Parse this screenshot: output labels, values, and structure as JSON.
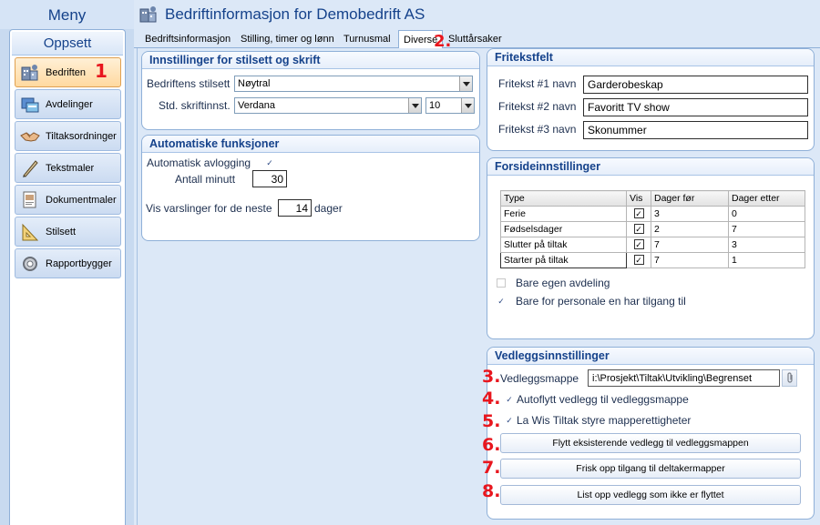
{
  "menu": {
    "title": "Meny",
    "section": "Oppsett",
    "items": [
      {
        "label": "Bedriften",
        "icon": "company-icon"
      },
      {
        "label": "Avdelinger",
        "icon": "department-icon"
      },
      {
        "label": "Tiltaksordninger",
        "icon": "handshake-icon"
      },
      {
        "label": "Tekstmaler",
        "icon": "text-template-icon"
      },
      {
        "label": "Dokumentmaler",
        "icon": "document-template-icon"
      },
      {
        "label": "Stilsett",
        "icon": "stylesheet-icon"
      },
      {
        "label": "Rapportbygger",
        "icon": "report-builder-icon"
      }
    ]
  },
  "annotations": {
    "m1": "1",
    "m2": "2.",
    "m3": "3.",
    "m4": "4.",
    "m5": "5.",
    "m6": "6.",
    "m7": "7.",
    "m8": "8."
  },
  "page": {
    "title": "Bedriftinformasjon for Demobedrift AS"
  },
  "tabs": [
    "Bedriftsinformasjon",
    "Stilling, timer og lønn",
    "Turnusmal",
    "Diverse",
    "Sluttårsaker"
  ],
  "style_settings": {
    "title": "Innstillinger for stilsett og skrift",
    "company_style_label": "Bedriftens stilsett",
    "company_style_value": "Nøytral",
    "font_label": "Std. skriftinnst.",
    "font_value": "Verdana",
    "font_size_value": "10"
  },
  "auto_functions": {
    "title": "Automatiske funksjoner",
    "auto_logout_label": "Automatisk avlogging",
    "auto_logout_checked": "✓",
    "minutes_label": "Antall minutt",
    "minutes_value": "30",
    "notify_label": "Vis varslinger for de neste",
    "notify_value": "14",
    "days_label": "dager"
  },
  "free_text": {
    "title": "Fritekstfelt",
    "fields": [
      {
        "label": "Fritekst #1 navn",
        "value": "Garderobeskap"
      },
      {
        "label": "Fritekst #2 navn",
        "value": "Favoritt TV show"
      },
      {
        "label": "Fritekst #3 navn",
        "value": "Skonummer"
      }
    ]
  },
  "front_page": {
    "title": "Forsideinnstillinger",
    "columns": [
      "Type",
      "Vis",
      "Dager før",
      "Dager etter"
    ],
    "rows": [
      {
        "type": "Ferie",
        "vis": "✓",
        "before": "3",
        "after": "0"
      },
      {
        "type": "Fødselsdager",
        "vis": "✓",
        "before": "2",
        "after": "7"
      },
      {
        "type": "Slutter på tiltak",
        "vis": "✓",
        "before": "7",
        "after": "3"
      },
      {
        "type": "Starter på tiltak",
        "vis": "✓",
        "before": "7",
        "after": "1"
      }
    ],
    "own_department_label": "Bare egen avdeling",
    "own_department_checked": "",
    "staff_access_label": "Bare for personale en har tilgang til",
    "staff_access_checked": "✓"
  },
  "attachments": {
    "title": "Vedleggsinnstillinger",
    "folder_label": "Vedleggsmappe",
    "folder_value": "i:\\Prosjekt\\Tiltak\\Utvikling\\Begrenset",
    "auto_move_label": "Autoflytt vedlegg til vedleggsmappe",
    "auto_move_checked": "✓",
    "permissions_label": "La Wis Tiltak styre mapperettigheter",
    "permissions_checked": "✓",
    "move_button": "Flytt eksisterende vedlegg til vedleggsmappen",
    "refresh_button": "Frisk opp tilgang til deltakermapper",
    "list_button": "List opp vedlegg som ikke er flyttet"
  }
}
